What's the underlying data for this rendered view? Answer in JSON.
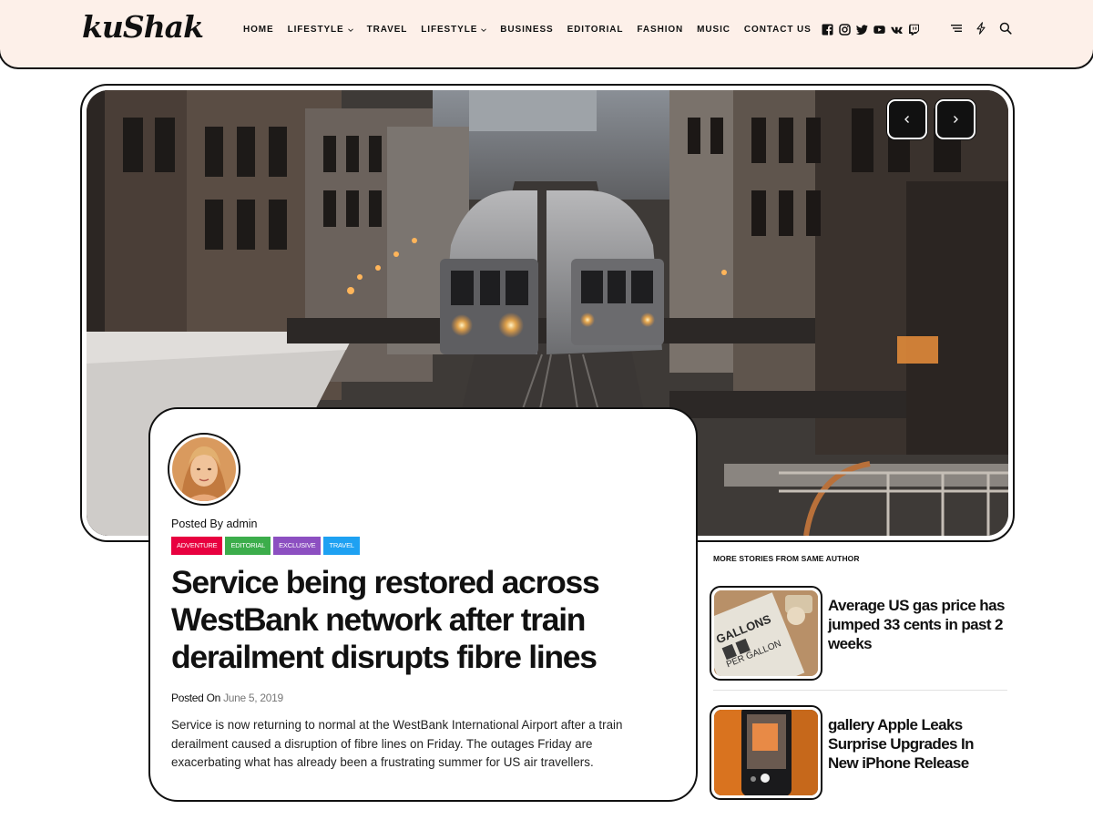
{
  "site": {
    "logo": "kuShak"
  },
  "nav": {
    "items": [
      {
        "label": "HOME",
        "has_dropdown": false
      },
      {
        "label": "LIFESTYLE",
        "has_dropdown": true
      },
      {
        "label": "TRAVEL",
        "has_dropdown": false
      },
      {
        "label": "LIFESTYLE",
        "has_dropdown": true
      },
      {
        "label": "BUSINESS",
        "has_dropdown": false
      },
      {
        "label": "EDITORIAL",
        "has_dropdown": false
      },
      {
        "label": "FASHION",
        "has_dropdown": false
      },
      {
        "label": "MUSIC",
        "has_dropdown": false
      },
      {
        "label": "CONTACT US",
        "has_dropdown": false
      }
    ]
  },
  "socials": [
    "facebook-icon",
    "instagram-icon",
    "twitter-icon",
    "youtube-icon",
    "vk-icon",
    "twitch-icon"
  ],
  "tools": [
    "menu-icon",
    "bolt-icon",
    "search-icon"
  ],
  "hero": {
    "image": "elevated-train-city-photo",
    "prev_icon": "chevron-left-icon",
    "next_icon": "chevron-right-icon"
  },
  "article": {
    "posted_by": "Posted By admin",
    "tags": [
      {
        "label": "ADVENTURE",
        "color": "#e8003f"
      },
      {
        "label": "EDITORIAL",
        "color": "#3cad4b"
      },
      {
        "label": "EXCLUSIVE",
        "color": "#8c4fc1"
      },
      {
        "label": "TRAVEL",
        "color": "#1ea1f2"
      }
    ],
    "title": "Service being restored across WestBank network after train derailment disrupts fibre lines",
    "posted_on_label": "Posted On",
    "posted_on_date": "June 5, 2019",
    "excerpt": "Service is now returning to normal at the WestBank International Airport after a train derailment caused a disruption of fibre lines on Friday. The outages Friday are exacerbating what has already been a frustrating summer for US air travellers."
  },
  "sidebar": {
    "title": "MORE STORIES FROM SAME AUTHOR",
    "stories": [
      {
        "title": "Average US gas price has jumped 33 cents in past 2 weeks",
        "thumb_text": [
          "GALLONS",
          "PER GALLON"
        ]
      },
      {
        "title": "gallery Apple Leaks Surprise Upgrades In New iPhone Release"
      }
    ]
  }
}
